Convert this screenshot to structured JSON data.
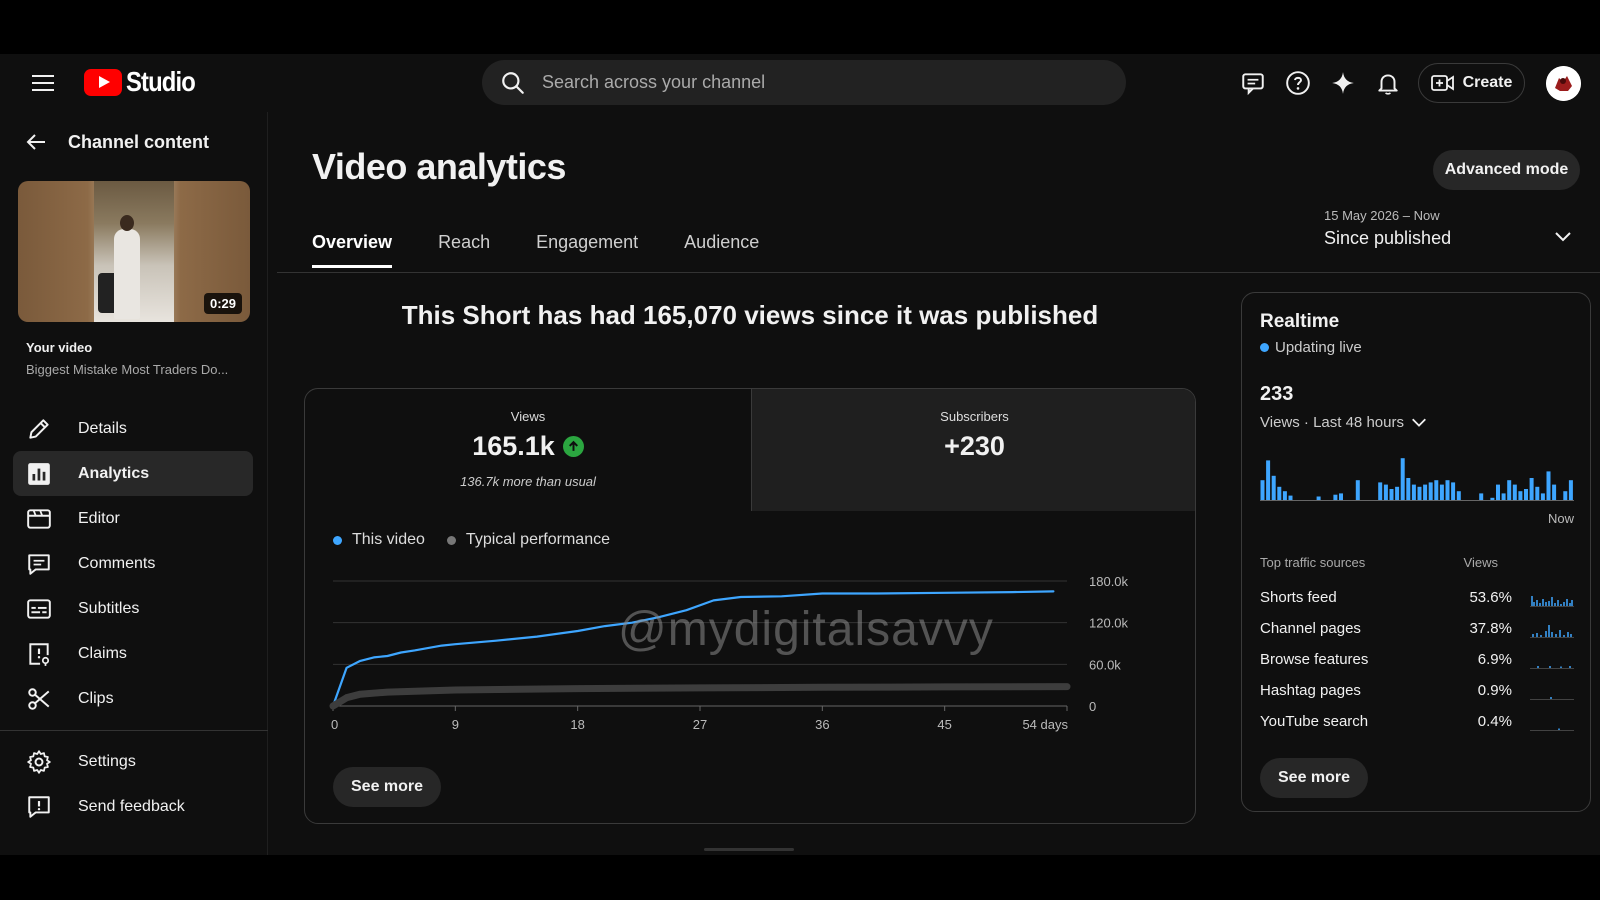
{
  "header": {
    "logo_text": "Studio",
    "search_placeholder": "Search across your channel",
    "create_label": "Create"
  },
  "sidebar": {
    "back_label": "Channel content",
    "thumbnail_duration": "0:29",
    "your_video_label": "Your video",
    "video_title": "Biggest Mistake Most Traders Do...",
    "items": [
      {
        "label": "Details",
        "icon": "pencil-icon"
      },
      {
        "label": "Analytics",
        "icon": "analytics-icon",
        "active": true
      },
      {
        "label": "Editor",
        "icon": "editor-icon"
      },
      {
        "label": "Comments",
        "icon": "comments-icon"
      },
      {
        "label": "Subtitles",
        "icon": "subtitles-icon"
      },
      {
        "label": "Claims",
        "icon": "claims-icon"
      },
      {
        "label": "Clips",
        "icon": "scissors-icon"
      }
    ],
    "bottom_items": [
      {
        "label": "Settings",
        "icon": "gear-icon"
      },
      {
        "label": "Send feedback",
        "icon": "feedback-icon"
      }
    ]
  },
  "main": {
    "title": "Video analytics",
    "advanced_mode_label": "Advanced mode",
    "tabs": [
      {
        "label": "Overview",
        "active": true
      },
      {
        "label": "Reach"
      },
      {
        "label": "Engagement"
      },
      {
        "label": "Audience"
      }
    ],
    "date_range_small": "15 May 2026 – Now",
    "date_range_label": "Since published",
    "headline": "This Short has had 165,070 views since it was published",
    "metrics": {
      "views_label": "Views",
      "views_value": "165.1k",
      "views_sub": "136.7k more than usual",
      "subs_label": "Subscribers",
      "subs_value": "+230"
    },
    "legend": {
      "this_video": "This video",
      "typical": "Typical performance"
    },
    "see_more_label": "See more",
    "watermark": "@mydigitalsavvy"
  },
  "colors": {
    "accent_blue": "#3ea6ff",
    "typical_gray": "#3d3d3d",
    "positive_green": "#2ba640"
  },
  "chart_data": {
    "type": "line",
    "x_unit": "days",
    "x_ticks": [
      "0",
      "9",
      "18",
      "27",
      "36",
      "45",
      "54 days"
    ],
    "y_ticks": [
      "0",
      "60.0k",
      "120.0k",
      "180.0k"
    ],
    "ylim": [
      0,
      180000
    ],
    "xlim": [
      0,
      54
    ],
    "series": [
      {
        "name": "This video",
        "color": "#3ea6ff",
        "x": [
          0,
          1,
          2,
          3,
          4,
          5,
          6,
          8,
          9,
          12,
          15,
          18,
          20,
          22,
          24,
          26,
          28,
          30,
          33,
          36,
          40,
          45,
          50,
          53
        ],
        "values": [
          0,
          55000,
          65000,
          70000,
          72000,
          77000,
          80000,
          87000,
          89000,
          94000,
          100000,
          108000,
          115000,
          120000,
          128000,
          138000,
          152000,
          157000,
          158000,
          162000,
          162000,
          163000,
          164000,
          165070
        ]
      },
      {
        "name": "Typical performance",
        "color": "#3d3d3d",
        "x": [
          0,
          1,
          2,
          4,
          9,
          18,
          27,
          36,
          45,
          54
        ],
        "values": [
          0,
          12000,
          17000,
          20000,
          23000,
          25000,
          26000,
          27000,
          27500,
          28000
        ]
      }
    ]
  },
  "realtime": {
    "title": "Realtime",
    "live_label": "Updating live",
    "count": "233",
    "period_label": "Views · Last 48 hours",
    "now_label": "Now",
    "bars": [
      0.45,
      0.9,
      0.55,
      0.3,
      0.2,
      0.1,
      0,
      0,
      0,
      0,
      0.08,
      0,
      0,
      0.12,
      0.15,
      0,
      0,
      0.45,
      0,
      0,
      0,
      0.4,
      0.35,
      0.25,
      0.3,
      0.95,
      0.5,
      0.35,
      0.3,
      0.35,
      0.4,
      0.45,
      0.35,
      0.45,
      0.4,
      0.2,
      0,
      0,
      0,
      0.15,
      0,
      0.05,
      0.35,
      0.15,
      0.45,
      0.35,
      0.2,
      0.25,
      0.5,
      0.3,
      0.15,
      0.65,
      0.35,
      0,
      0.2,
      0.45
    ],
    "traffic_header": "Top traffic sources",
    "views_header": "Views",
    "traffic_sources": [
      {
        "name": "Shorts feed",
        "pct": "53.6%"
      },
      {
        "name": "Channel pages",
        "pct": "37.8%"
      },
      {
        "name": "Browse features",
        "pct": "6.9%"
      },
      {
        "name": "Hashtag pages",
        "pct": "0.9%"
      },
      {
        "name": "YouTube search",
        "pct": "0.4%"
      }
    ],
    "see_more_label": "See more"
  }
}
